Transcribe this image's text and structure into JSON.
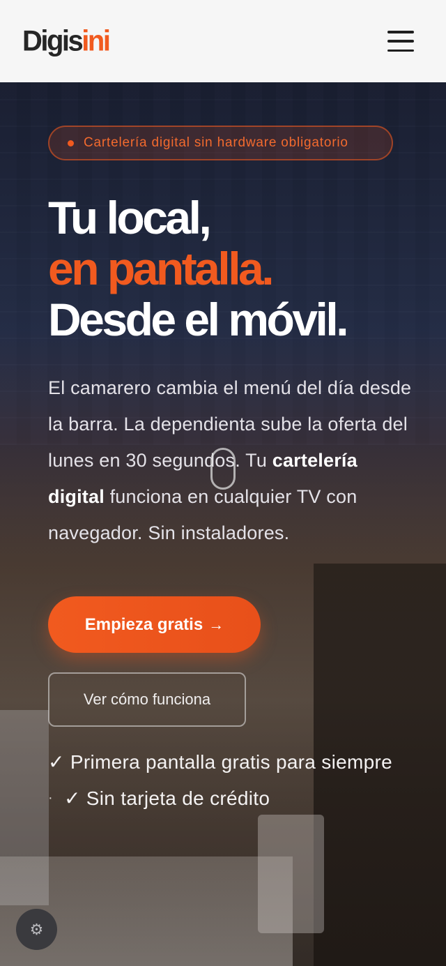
{
  "header": {
    "logo_part1": "Digis",
    "logo_part2": "ini",
    "menu_icon": "hamburger-menu-icon"
  },
  "hero": {
    "badge": "Cartelería digital sin hardware obligatorio",
    "headline_line1": "Tu local,",
    "headline_line2": "en pantalla.",
    "headline_line3": "Desde el móvil.",
    "description_part1": "El camarero cambia el menú del día desde la barra. La dependienta sube la oferta del lunes en 30 segundos. Tu ",
    "description_bold": "cartelería digital",
    "description_part2": " funciona en cualquier TV con navegador. Sin instaladores.",
    "cta_primary": "Empieza gratis",
    "cta_arrow": "→",
    "cta_secondary": "Ver cómo funciona",
    "perk1": "✓ Primera pantalla gratis para siempre",
    "perk_separator": "·",
    "perk2": "✓ Sin tarjeta de crédito"
  },
  "settings_icon": "gear-icon",
  "colors": {
    "accent": "#f15a1f",
    "header_bg": "#f6f6f6",
    "logo_dark": "#262626"
  }
}
